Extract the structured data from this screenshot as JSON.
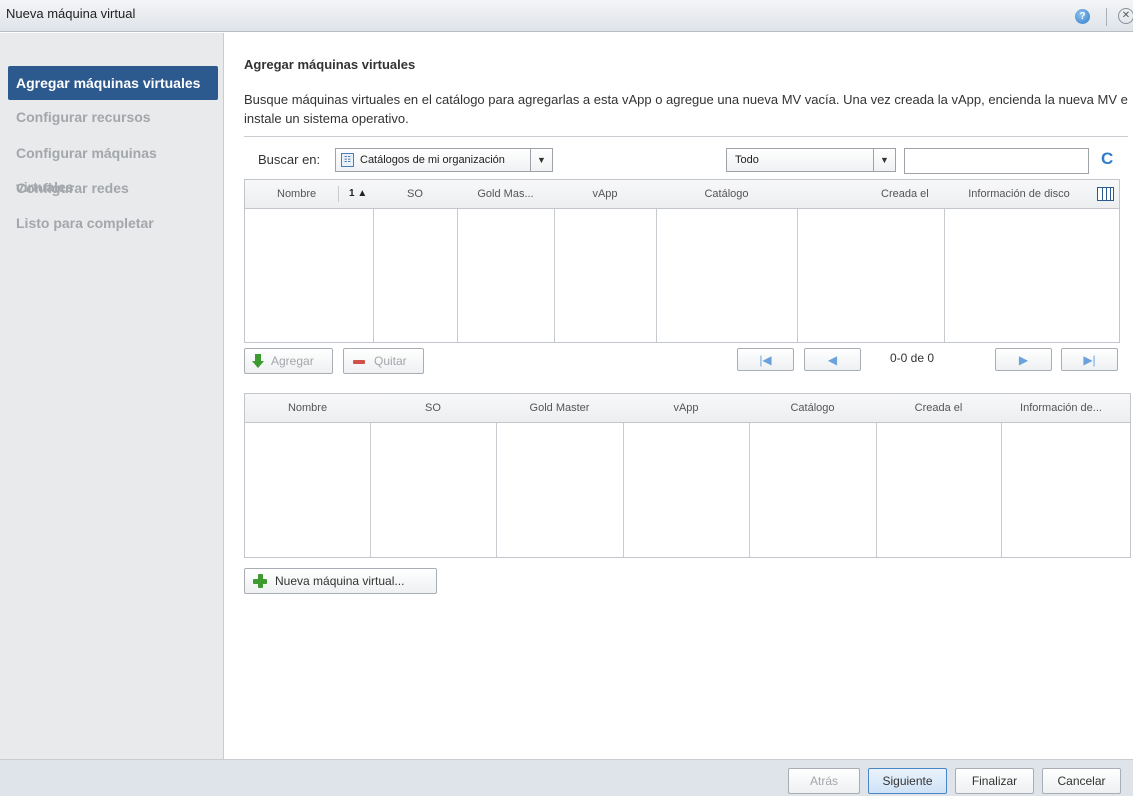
{
  "window": {
    "title": "Nueva máquina virtual",
    "help_glyph": "?",
    "close_glyph": "✕"
  },
  "sidebar": {
    "items": [
      {
        "label": "Agregar máquinas virtuales",
        "active": true
      },
      {
        "label": "Configurar recursos",
        "active": false
      },
      {
        "label": "Configurar máquinas virtuales",
        "active": false
      },
      {
        "label": "Configurar redes",
        "active": false
      },
      {
        "label": "Listo para completar",
        "active": false
      }
    ]
  },
  "main": {
    "heading": "Agregar máquinas virtuales",
    "description": "Busque máquinas virtuales en el catálogo para agregarlas a esta vApp o agregue una nueva MV vacía. Una vez creada la vApp, encienda la nueva MV e instale un sistema operativo.",
    "search": {
      "label": "Buscar en:",
      "catalog_select": "Catálogos de mi organización",
      "filter_select": "Todo",
      "text_value": "",
      "refresh_glyph": "C"
    },
    "catalog_grid": {
      "columns": [
        "Nombre",
        "SO",
        "Gold Mas...",
        "vApp",
        "Catálogo",
        "Creada el",
        "Información de disco"
      ],
      "sort_indicator": "1 ▲",
      "rows": []
    },
    "actions": {
      "add_label": "Agregar",
      "remove_label": "Quitar"
    },
    "pager": {
      "info": "0-0 de 0",
      "first_glyph": "|◀",
      "prev_glyph": "◀",
      "next_glyph": "▶",
      "last_glyph": "▶|"
    },
    "selected_grid": {
      "columns": [
        "Nombre",
        "SO",
        "Gold Master",
        "vApp",
        "Catálogo",
        "Creada el",
        "Información de..."
      ],
      "rows": []
    },
    "new_vm_label": "Nueva máquina virtual..."
  },
  "footer": {
    "back_label": "Atrás",
    "next_label": "Siguiente",
    "finish_label": "Finalizar",
    "cancel_label": "Cancelar"
  },
  "colors": {
    "sidebar_active": "#2d5a8e",
    "accent_blue": "#2f7cc8",
    "add_green": "#3c9a2e",
    "remove_red": "#d2504a"
  }
}
